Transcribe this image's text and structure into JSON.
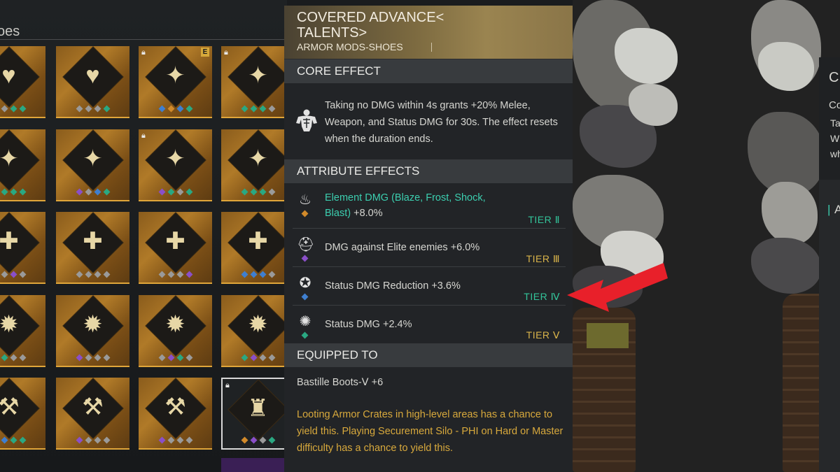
{
  "inventory": {
    "category_label": "oes",
    "tiles": [
      {
        "row": 0,
        "col": 0,
        "glyph": "♥",
        "locked": false,
        "gems": [
          "#9a9a9a",
          "#9a9a9a",
          "#2aa882",
          "#2aa882"
        ]
      },
      {
        "row": 0,
        "col": 1,
        "glyph": "♥",
        "locked": false,
        "gems": [
          "#9a9a9a",
          "#9a9a9a",
          "#9a9a9a",
          "#2aa882"
        ]
      },
      {
        "row": 0,
        "col": 2,
        "glyph": "✦",
        "locked": true,
        "badge": "E",
        "gems": [
          "#3f7fd0",
          "#d28a2a",
          "#3f7fd0",
          "#2aa882"
        ]
      },
      {
        "row": 0,
        "col": 3,
        "glyph": "✦",
        "locked": true,
        "gems": [
          "#2aa882",
          "#2aa882",
          "#2aa882",
          "#9a9a9a"
        ]
      },
      {
        "row": 1,
        "col": 0,
        "glyph": "✦",
        "locked": false,
        "gems": [
          "#8a4fc8",
          "#2aa882",
          "#2aa882",
          "#2aa882"
        ]
      },
      {
        "row": 1,
        "col": 1,
        "glyph": "✦",
        "locked": false,
        "gems": [
          "#8a4fc8",
          "#9a9a9a",
          "#3f7fd0",
          "#2aa882"
        ]
      },
      {
        "row": 1,
        "col": 2,
        "glyph": "✦",
        "locked": true,
        "gems": [
          "#8a4fc8",
          "#2aa882",
          "#9a9a9a",
          "#2aa882"
        ]
      },
      {
        "row": 1,
        "col": 3,
        "glyph": "✦",
        "locked": false,
        "gems": [
          "#2aa882",
          "#2aa882",
          "#2aa882",
          "#9a9a9a"
        ]
      },
      {
        "row": 2,
        "col": 0,
        "glyph": "✚",
        "locked": false,
        "gems": [
          "#9a9a9a",
          "#9a9a9a",
          "#8a4fc8",
          "#9a9a9a"
        ]
      },
      {
        "row": 2,
        "col": 1,
        "glyph": "✚",
        "locked": false,
        "gems": [
          "#9a9a9a",
          "#9a9a9a",
          "#9a9a9a",
          "#9a9a9a"
        ]
      },
      {
        "row": 2,
        "col": 2,
        "glyph": "✚",
        "locked": false,
        "gems": [
          "#9a9a9a",
          "#9a9a9a",
          "#9a9a9a",
          "#8a4fc8"
        ]
      },
      {
        "row": 2,
        "col": 3,
        "glyph": "✚",
        "locked": false,
        "gems": [
          "#3f7fd0",
          "#3f7fd0",
          "#3f7fd0",
          "#9a9a9a"
        ]
      },
      {
        "row": 3,
        "col": 0,
        "glyph": "✹",
        "locked": false,
        "gems": [
          "#2aa882",
          "#2aa882",
          "#9a9a9a",
          "#9a9a9a"
        ]
      },
      {
        "row": 3,
        "col": 1,
        "glyph": "✹",
        "locked": false,
        "gems": [
          "#8a4fc8",
          "#9a9a9a",
          "#9a9a9a",
          "#9a9a9a"
        ]
      },
      {
        "row": 3,
        "col": 2,
        "glyph": "✹",
        "locked": false,
        "gems": [
          "#9a9a9a",
          "#8a4fc8",
          "#2aa882",
          "#9a9a9a"
        ]
      },
      {
        "row": 3,
        "col": 3,
        "glyph": "✹",
        "locked": false,
        "gems": [
          "#2aa882",
          "#8a4fc8",
          "#9a9a9a",
          "#9a9a9a"
        ]
      },
      {
        "row": 4,
        "col": 0,
        "glyph": "⚒",
        "locked": false,
        "gems": [
          "#9a9a9a",
          "#3f7fd0",
          "#2aa882",
          "#2aa882"
        ]
      },
      {
        "row": 4,
        "col": 1,
        "glyph": "⚒",
        "locked": false,
        "gems": [
          "#8a4fc8",
          "#9a9a9a",
          "#9a9a9a",
          "#9a9a9a"
        ]
      },
      {
        "row": 4,
        "col": 2,
        "glyph": "⚒",
        "locked": false,
        "gems": [
          "#8a4fc8",
          "#9a9a9a",
          "#9a9a9a",
          "#9a9a9a"
        ]
      },
      {
        "row": 4,
        "col": 3,
        "glyph": "♜",
        "locked": true,
        "selected": true,
        "gems": [
          "#d28a2a",
          "#8a4fc8",
          "#9a9a9a",
          "#2aa882"
        ]
      }
    ]
  },
  "item": {
    "title": "COVERED ADVANCE<\nTALENTS>",
    "type": "ARMOR MODS-SHOES"
  },
  "core_effect": {
    "heading": "CORE EFFECT",
    "icon": "muscle-torso-icon",
    "text": "Taking no DMG within 4s grants +20% Melee, Weapon, and Status DMG for 30s. The effect resets when the duration ends."
  },
  "attribute_effects": {
    "heading": "ATTRIBUTE EFFECTS",
    "rows": [
      {
        "icon": "element-flame-icon",
        "gem_color": "#d28a2a",
        "highlight": "Element DMG (Blaze, Frost, Shock, Blast)",
        "value": " +8.0%",
        "tier": "TIER Ⅱ",
        "tier_color": "green"
      },
      {
        "icon": "elite-helmet-icon",
        "gem_color": "#8a4fc8",
        "highlight": "",
        "value": "DMG against Elite enemies +6.0%",
        "tier": "TIER Ⅲ",
        "tier_color": "gold"
      },
      {
        "icon": "status-shield-icon",
        "gem_color": "#3f7fd0",
        "highlight": "",
        "value": "Status DMG Reduction +3.6%",
        "tier": "TIER Ⅳ",
        "tier_color": "green"
      },
      {
        "icon": "status-burst-icon",
        "gem_color": "#2aa882",
        "highlight": "",
        "value": "Status DMG +2.4%",
        "tier": "TIER Ⅴ",
        "tier_color": "gold"
      }
    ]
  },
  "equipped": {
    "heading": "EQUIPPED TO",
    "value": "Bastille Boots-Ⅴ +6"
  },
  "source_text": "Looting Armor Crates in high-level areas has a chance to yield this. Playing Securement Silo - PHI on Hard or Master difficulty has a chance to yield this.",
  "right_panel": {
    "title_fragment": "C",
    "sub_fragment": "Co",
    "lines": [
      "Ta",
      "W",
      "wh"
    ],
    "section_fragment": "A"
  },
  "colors": {
    "tier_green": "#33c49a",
    "tier_gold": "#d9b44a",
    "highlight_teal": "#3ccfb0",
    "source_gold": "#d8a93c",
    "annotation_arrow": "#e8202a"
  }
}
